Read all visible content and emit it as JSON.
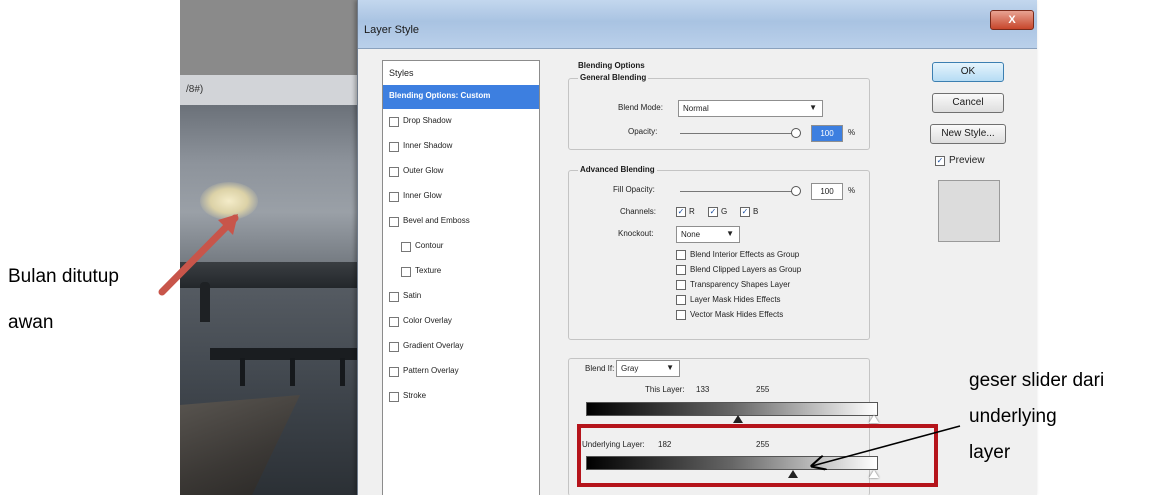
{
  "photo": {
    "window_title": "/8#)"
  },
  "dialog": {
    "title": "Layer Style",
    "close_label": "X",
    "styles_header": "Styles",
    "style_items": [
      {
        "label": "Blending Options: Custom",
        "selected": true,
        "indent": 0
      },
      {
        "label": "Drop Shadow",
        "selected": false,
        "indent": 0
      },
      {
        "label": "Inner Shadow",
        "selected": false,
        "indent": 0
      },
      {
        "label": "Outer Glow",
        "selected": false,
        "indent": 0
      },
      {
        "label": "Inner Glow",
        "selected": false,
        "indent": 0
      },
      {
        "label": "Bevel and Emboss",
        "selected": false,
        "indent": 0
      },
      {
        "label": "Contour",
        "selected": false,
        "indent": 1
      },
      {
        "label": "Texture",
        "selected": false,
        "indent": 1
      },
      {
        "label": "Satin",
        "selected": false,
        "indent": 0
      },
      {
        "label": "Color Overlay",
        "selected": false,
        "indent": 0
      },
      {
        "label": "Gradient Overlay",
        "selected": false,
        "indent": 0
      },
      {
        "label": "Pattern Overlay",
        "selected": false,
        "indent": 0
      },
      {
        "label": "Stroke",
        "selected": false,
        "indent": 0
      }
    ],
    "blending_options": {
      "title": "Blending Options",
      "general_title": "General Blending",
      "blend_mode_label": "Blend Mode:",
      "blend_mode_value": "Normal",
      "opacity_label": "Opacity:",
      "opacity_value": "100",
      "percent": "%"
    },
    "advanced": {
      "title": "Advanced Blending",
      "fill_opacity_label": "Fill Opacity:",
      "fill_opacity_value": "100",
      "percent": "%",
      "channels_label": "Channels:",
      "channel_r": "R",
      "channel_g": "G",
      "channel_b": "B",
      "knockout_label": "Knockout:",
      "knockout_value": "None",
      "options": [
        "Blend Interior Effects as Group",
        "Blend Clipped Layers as Group",
        "Transparency Shapes Layer",
        "Layer Mask Hides Effects",
        "Vector Mask Hides Effects"
      ]
    },
    "blend_if": {
      "label": "Blend If:",
      "value": "Gray",
      "this_layer_label": "This Layer:",
      "this_layer_low": "133",
      "this_layer_high": "255",
      "underlying_label": "Underlying Layer:",
      "underlying_low": "182",
      "underlying_high": "255"
    },
    "buttons": {
      "ok": "OK",
      "cancel": "Cancel",
      "new_style": "New Style...",
      "preview": "Preview"
    }
  },
  "annotations": {
    "moon_note_line1": "Bulan ditutup",
    "moon_note_line2": "awan",
    "slider_note_line1": "geser slider dari",
    "slider_note_line2": "underlying",
    "slider_note_line3": "layer"
  },
  "colors": {
    "highlight_box": "#b5141b",
    "pointer_arrow": "#c8554a",
    "selected_style": "#3d7fe0"
  }
}
